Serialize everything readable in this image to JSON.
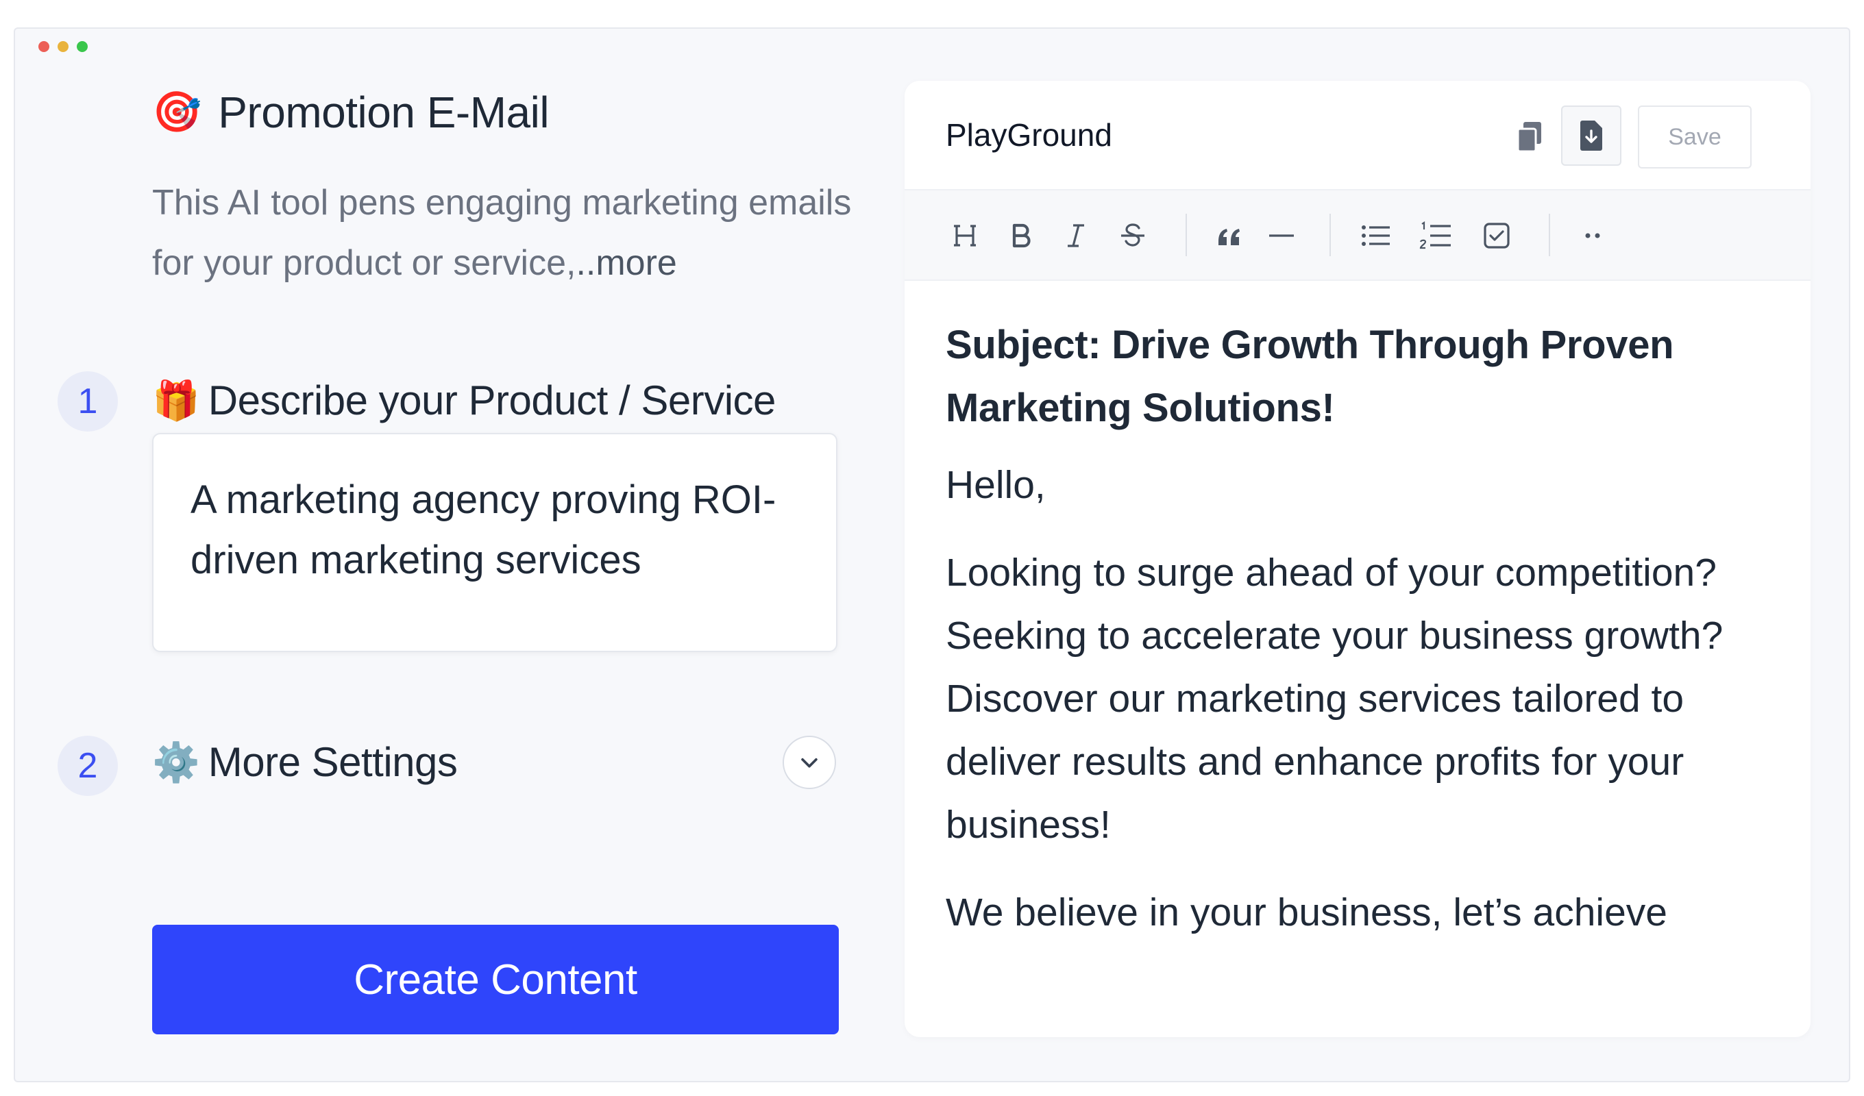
{
  "window": {
    "traffic_colors": [
      "#ec5f57",
      "#e9b33d",
      "#3ac64c"
    ]
  },
  "tool": {
    "emoji": "🎯",
    "title": "Promotion E-Mail",
    "description": "This AI tool pens engaging marketing emails for your product or service,",
    "more_label": "..more"
  },
  "steps": [
    {
      "number": "1",
      "emoji": "🎁",
      "label": "Describe your Product / Service",
      "value": "A marketing agency proving ROI-driven marketing services"
    },
    {
      "number": "2",
      "emoji": "⚙️",
      "label": "More Settings"
    }
  ],
  "create_button": "Create Content",
  "accent_color": "#2f45fb",
  "playground": {
    "title": "PlayGround",
    "copy_icon": "copy-icon",
    "download_icon": "download-icon",
    "save_label": "Save",
    "toolbar": [
      "heading-icon",
      "bold-icon",
      "italic-icon",
      "strikethrough-icon",
      "quote-icon",
      "horizontal-rule-icon",
      "bullet-list-icon",
      "numbered-list-icon",
      "checklist-icon",
      "more-icon"
    ],
    "document": {
      "subject": "Subject: Drive Growth Through Proven Marketing Solutions!",
      "greeting": "Hello,",
      "paragraph1": "Looking to surge ahead of your competition? Seeking to accelerate your business growth? Discover our marketing services tailored to deliver results and enhance profits for your business!",
      "paragraph2": "We believe in your business, let’s achieve"
    }
  }
}
